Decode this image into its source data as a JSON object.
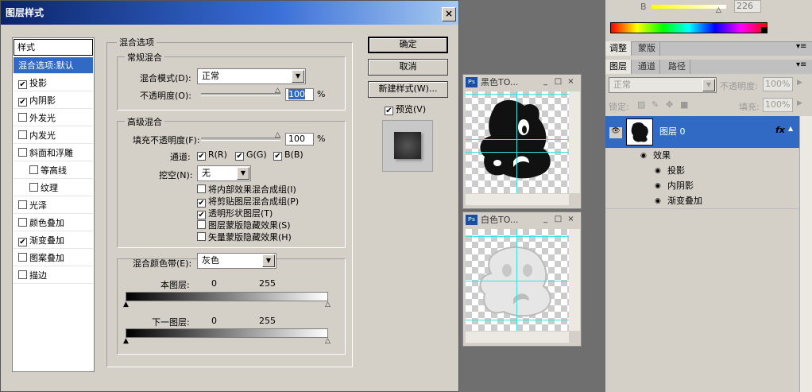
{
  "dialog": {
    "title": "图层样式",
    "close": "×",
    "styles_header": "样式",
    "styles_list": [
      {
        "label": "混合选项:默认",
        "checkbox": false,
        "checked": false,
        "selected": true
      },
      {
        "label": "投影",
        "checkbox": true,
        "checked": true
      },
      {
        "label": "内阴影",
        "checkbox": true,
        "checked": true
      },
      {
        "label": "外发光",
        "checkbox": true,
        "checked": false
      },
      {
        "label": "内发光",
        "checkbox": true,
        "checked": false
      },
      {
        "label": "斜面和浮雕",
        "checkbox": true,
        "checked": false
      },
      {
        "label": "等高线",
        "checkbox": true,
        "checked": false,
        "indent": true
      },
      {
        "label": "纹理",
        "checkbox": true,
        "checked": false,
        "indent": true
      },
      {
        "label": "光泽",
        "checkbox": true,
        "checked": false
      },
      {
        "label": "颜色叠加",
        "checkbox": true,
        "checked": false
      },
      {
        "label": "渐变叠加",
        "checkbox": true,
        "checked": true
      },
      {
        "label": "图案叠加",
        "checkbox": true,
        "checked": false
      },
      {
        "label": "描边",
        "checkbox": true,
        "checked": false
      }
    ],
    "blend_options": {
      "legend": "混合选项",
      "general": {
        "legend": "常规混合",
        "mode_label": "混合模式(D):",
        "mode_value": "正常",
        "opacity_label": "不透明度(O):",
        "opacity_value": "100",
        "opacity_unit": "%"
      },
      "advanced": {
        "legend": "高级混合",
        "fill_label": "填充不透明度(F):",
        "fill_value": "100",
        "fill_unit": "%",
        "channels_label": "通道:",
        "channels": [
          "R(R)",
          "G(G)",
          "B(B)"
        ],
        "knockout_label": "挖空(N):",
        "knockout_value": "无",
        "options": [
          {
            "label": "将内部效果混合成组(I)",
            "checked": false
          },
          {
            "label": "将剪贴图层混合成组(P)",
            "checked": true
          },
          {
            "label": "透明形状图层(T)",
            "checked": true
          },
          {
            "label": "图层蒙版隐藏效果(S)",
            "checked": false
          },
          {
            "label": "矢量蒙版隐藏效果(H)",
            "checked": false
          }
        ]
      },
      "blend_if": {
        "label": "混合颜色带(E):",
        "value": "灰色",
        "this_layer": "本图层:",
        "this_min": "0",
        "this_max": "255",
        "under_layer": "下一图层:",
        "under_min": "0",
        "under_max": "255"
      }
    },
    "buttons": {
      "ok": "确定",
      "cancel": "取消",
      "new_style": "新建样式(W)...",
      "preview_label": "预览(V)",
      "preview_checked": true
    }
  },
  "doc_windows": [
    {
      "title": "黑色TO...",
      "icon": "Ps"
    },
    {
      "title": "白色TO...",
      "icon": "Ps"
    }
  ],
  "right_panel": {
    "b_label": "B",
    "b_value": "226",
    "tabs_top": [
      "调整",
      "蒙版"
    ],
    "tabs_layers": [
      "图层",
      "通道",
      "路径"
    ],
    "blend_mode": "正常",
    "opacity_label": "不透明度:",
    "opacity_value": "100%",
    "lock_label": "锁定:",
    "fill_label": "填充:",
    "fill_value": "100%",
    "layer_name": "图层 0",
    "fx_label": "fx",
    "effects_label": "效果",
    "effects": [
      "投影",
      "内阴影",
      "渐变叠加"
    ]
  },
  "colors": {
    "title_bar": "#0a246a",
    "selection": "#316ac5",
    "dialog_bg": "#d4d0c8",
    "guide": "#3fe0e0"
  }
}
